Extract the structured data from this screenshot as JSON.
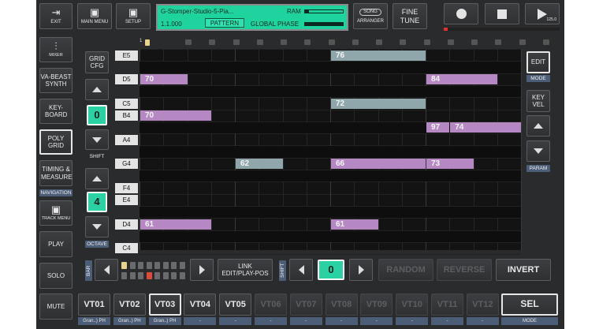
{
  "header": {
    "exit": "EXIT",
    "main_menu": "MAIN MENU",
    "setup": "SETUP",
    "lcd_title": "G-Stomper-Studio-5-Pia...",
    "lcd_position": "1.1.000",
    "lcd_pattern": "PATTERN",
    "lcd_ram": "RAM",
    "lcd_global_phase": "GLOBAL PHASE",
    "ram_level": 0.1,
    "song": "SONG",
    "arranger": "ARRANGER",
    "fine_tune": "FINE TUNE",
    "bpm": "125.0",
    "record_icon": "record-icon",
    "stop_icon": "stop-icon",
    "play_icon": "play-icon"
  },
  "sidebar": {
    "mixer": "MIXER",
    "va_beast": "VA-BEAST SYNTH",
    "keyboard": "KEY-BOARD",
    "poly_grid": "POLY GRID",
    "timing": "TIMING & MEASURE",
    "navigation": "NAVIGATION",
    "track_menu": "TRACK MENU",
    "play": "PLAY",
    "solo": "SOLO",
    "mute": "MUTE"
  },
  "leftcontrols": {
    "grid_cfg": "GRID CFG",
    "shift_value": "0",
    "shift_label": "SHIFT",
    "octave_value": "4",
    "octave_label": "OCTAVE"
  },
  "keys": [
    "E5",
    "D5",
    "C5",
    "B4",
    "A4",
    "G4",
    "F4",
    "E4",
    "D4",
    "C4"
  ],
  "top_marker_number": "1",
  "notes": [
    {
      "value": "76",
      "color": "teal"
    },
    {
      "value": "70",
      "color": "purple"
    },
    {
      "value": "84",
      "color": "purple"
    },
    {
      "value": "72",
      "color": "teal"
    },
    {
      "value": "70",
      "color": "purple"
    },
    {
      "value": "74",
      "color": "purple"
    },
    {
      "value": "97",
      "color": "purple"
    },
    {
      "value": "62",
      "color": "teal"
    },
    {
      "value": "66",
      "color": "purple"
    },
    {
      "value": "73",
      "color": "purple"
    },
    {
      "value": "61",
      "color": "purple"
    },
    {
      "value": "61",
      "color": "purple"
    }
  ],
  "right": {
    "edit": "EDIT",
    "mode": "MODE",
    "key_vel": "KEY VEL",
    "param": "PARAM"
  },
  "bottom": {
    "bar_label": "BAR",
    "link": "LINK EDIT/PLAY-POS",
    "shift_label": "SHIFT",
    "shift_value": "0",
    "random": "RANDOM",
    "reverse": "REVERSE",
    "invert": "INVERT"
  },
  "tracks": [
    {
      "label": "VT01",
      "sub": "Gran..) PH",
      "state": "normal"
    },
    {
      "label": "VT02",
      "sub": "Gran..) PH",
      "state": "normal"
    },
    {
      "label": "VT03",
      "sub": "Gran..) PH",
      "state": "selected"
    },
    {
      "label": "VT04",
      "sub": "-",
      "state": "normal"
    },
    {
      "label": "VT05",
      "sub": "-",
      "state": "normal"
    },
    {
      "label": "VT06",
      "sub": "-",
      "state": "dim"
    },
    {
      "label": "VT07",
      "sub": "-",
      "state": "dim"
    },
    {
      "label": "VT08",
      "sub": "-",
      "state": "dim"
    },
    {
      "label": "VT09",
      "sub": "-",
      "state": "dim"
    },
    {
      "label": "VT10",
      "sub": "-",
      "state": "dim"
    },
    {
      "label": "VT11",
      "sub": "-",
      "state": "dim"
    },
    {
      "label": "VT12",
      "sub": "-",
      "state": "dim"
    }
  ],
  "sel": "SEL",
  "sel_mode": "MODE",
  "colors": {
    "accent": "#2ad1a2",
    "note_purple": "#b588c4",
    "note_teal": "#8fa7aa",
    "sublabel": "#4b5d77"
  }
}
